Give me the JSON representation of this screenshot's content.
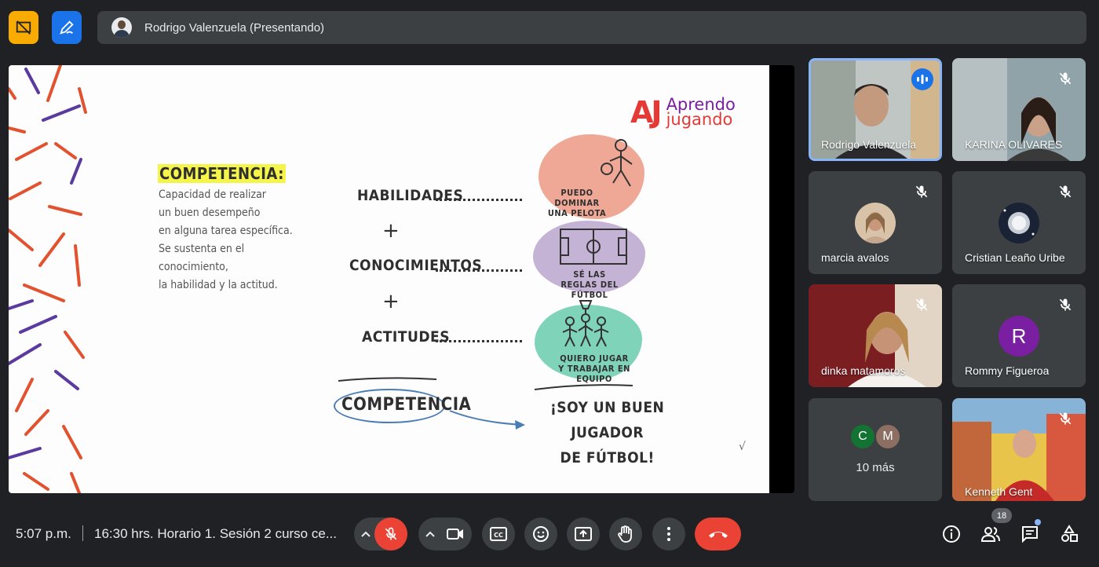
{
  "top_bar": {
    "presenter_label": "Rodrigo Valenzuela (Presentando)"
  },
  "slide": {
    "logo_mark": "AJ",
    "logo_line1": "Aprendo",
    "logo_line2": "jugando",
    "competencia_title": "COMPETENCIA:",
    "definition_lines": [
      "Capacidad de realizar",
      "un buen desempeño",
      "en alguna tarea específica.",
      "Se sustenta en el",
      "conocimiento,",
      "la habilidad y la actitud."
    ],
    "terms": [
      "HABILIDADES",
      "CONOCIMIENTOS",
      "ACTITUDES"
    ],
    "plus": "+",
    "blob_texts": [
      "PUEDO DOMINAR UNA PELOTA",
      "SÉ LAS REGLAS DEL FÚTBOL",
      "QUIERO JUGAR Y TRABAJAR EN EQUIPO"
    ],
    "competencia_word": "COMPETENCIA",
    "result_lines": [
      "¡SOY UN BUEN",
      "JUGADOR",
      "DE FÚTBOL!"
    ],
    "colors": {
      "yellow": "#f4f44a",
      "pink": "#f0a896",
      "purple": "#c5b3d6",
      "green": "#7fd3b8"
    }
  },
  "participants": [
    {
      "name": "Rodrigo Valenzuela",
      "speaking": true
    },
    {
      "name": "KARINA OLIVARES",
      "muted": true
    },
    {
      "name": "marcia avalos",
      "muted": true
    },
    {
      "name": "Cristian Leaño Uribe",
      "muted": true
    },
    {
      "name": "dinka matamoros",
      "muted": true
    },
    {
      "name": "Rommy Figueroa",
      "muted": true,
      "initial": "R"
    },
    {
      "name": "10 más",
      "initials": [
        "C",
        "M"
      ]
    },
    {
      "name": "Kenneth Gent",
      "muted": true
    }
  ],
  "bottom_bar": {
    "time": "5:07 p.m.",
    "meeting_title": "16:30 hrs. Horario 1. Sesión 2 curso ce...",
    "people_count": "18",
    "icons": [
      "mic-off-icon",
      "camera-icon",
      "captions-icon",
      "emoji-icon",
      "present-icon",
      "raise-hand-icon",
      "more-options-icon",
      "end-call-icon",
      "info-icon",
      "people-icon",
      "chat-icon",
      "activities-icon"
    ]
  }
}
